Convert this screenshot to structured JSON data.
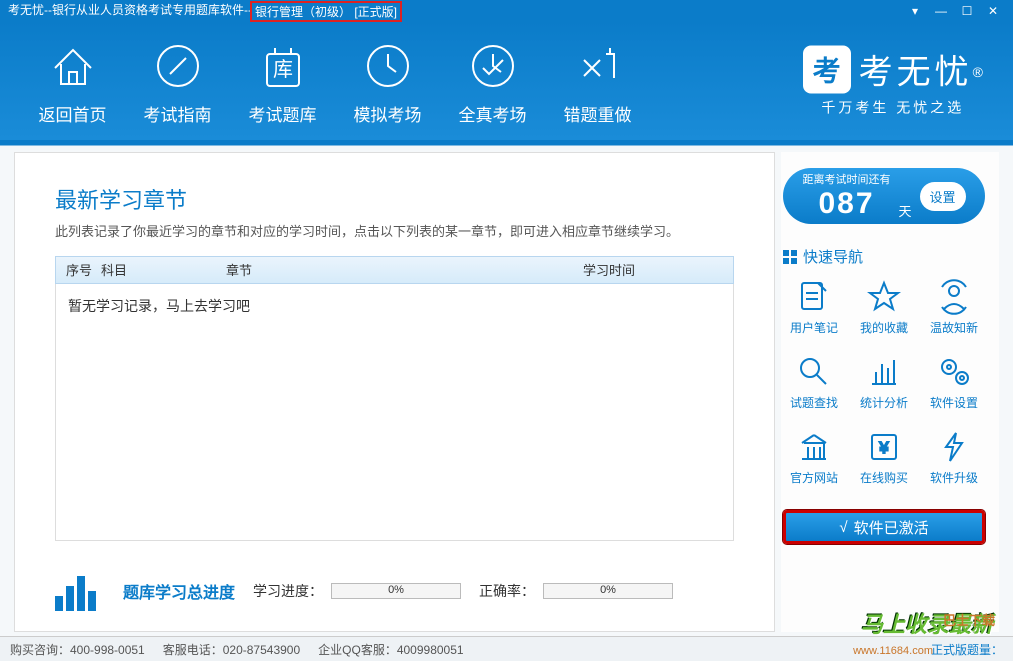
{
  "titlebar": {
    "prefix": "考无忧--银行从业人员资格考试专用题库软件--",
    "highlight": "银行管理（初级）  [正式版]"
  },
  "toolbar": {
    "items": [
      {
        "label": "返回首页"
      },
      {
        "label": "考试指南"
      },
      {
        "label": "考试题库"
      },
      {
        "label": "模拟考场"
      },
      {
        "label": "全真考场"
      },
      {
        "label": "错题重做"
      }
    ]
  },
  "brand": {
    "logo_char": "考",
    "name": "考无忧",
    "r": "®",
    "sub": "千万考生  无忧之选"
  },
  "main": {
    "title": "最新学习章节",
    "desc": "此列表记录了你最近学习的章节和对应的学习时间，点击以下列表的某一章节，即可进入相应章节继续学习。",
    "cols": {
      "idx": "序号",
      "subject": "科目",
      "chapter": "章节",
      "time": "学习时间"
    },
    "empty_msg": "暂无学习记录，马上去学习吧",
    "progress_title": "题库学习总进度",
    "study_label": "学习进度：",
    "study_pct": "0%",
    "correct_label": "正确率：",
    "correct_pct": "0%"
  },
  "side": {
    "countdown_label": "距离考试时间还有",
    "countdown_num": "087",
    "countdown_days": "天",
    "countdown_btn": "设置",
    "quicknav_title": "快速导航",
    "quicknav": [
      {
        "label": "用户笔记"
      },
      {
        "label": "我的收藏"
      },
      {
        "label": "温故知新"
      },
      {
        "label": "试题查找"
      },
      {
        "label": "统计分析"
      },
      {
        "label": "软件设置"
      },
      {
        "label": "官方网站"
      },
      {
        "label": "在线购买"
      },
      {
        "label": "软件升级"
      }
    ],
    "activated": "软件已激活"
  },
  "statusbar": {
    "buy": "购买咨询：400-998-0051",
    "phone": "客服电话：020-87543900",
    "qq": "企业QQ客服：4009980051",
    "right": "正式版题量："
  },
  "watermark1": "马上收录最新",
  "watermark2": "www.11684.com",
  "watermark3": "巴士下载"
}
